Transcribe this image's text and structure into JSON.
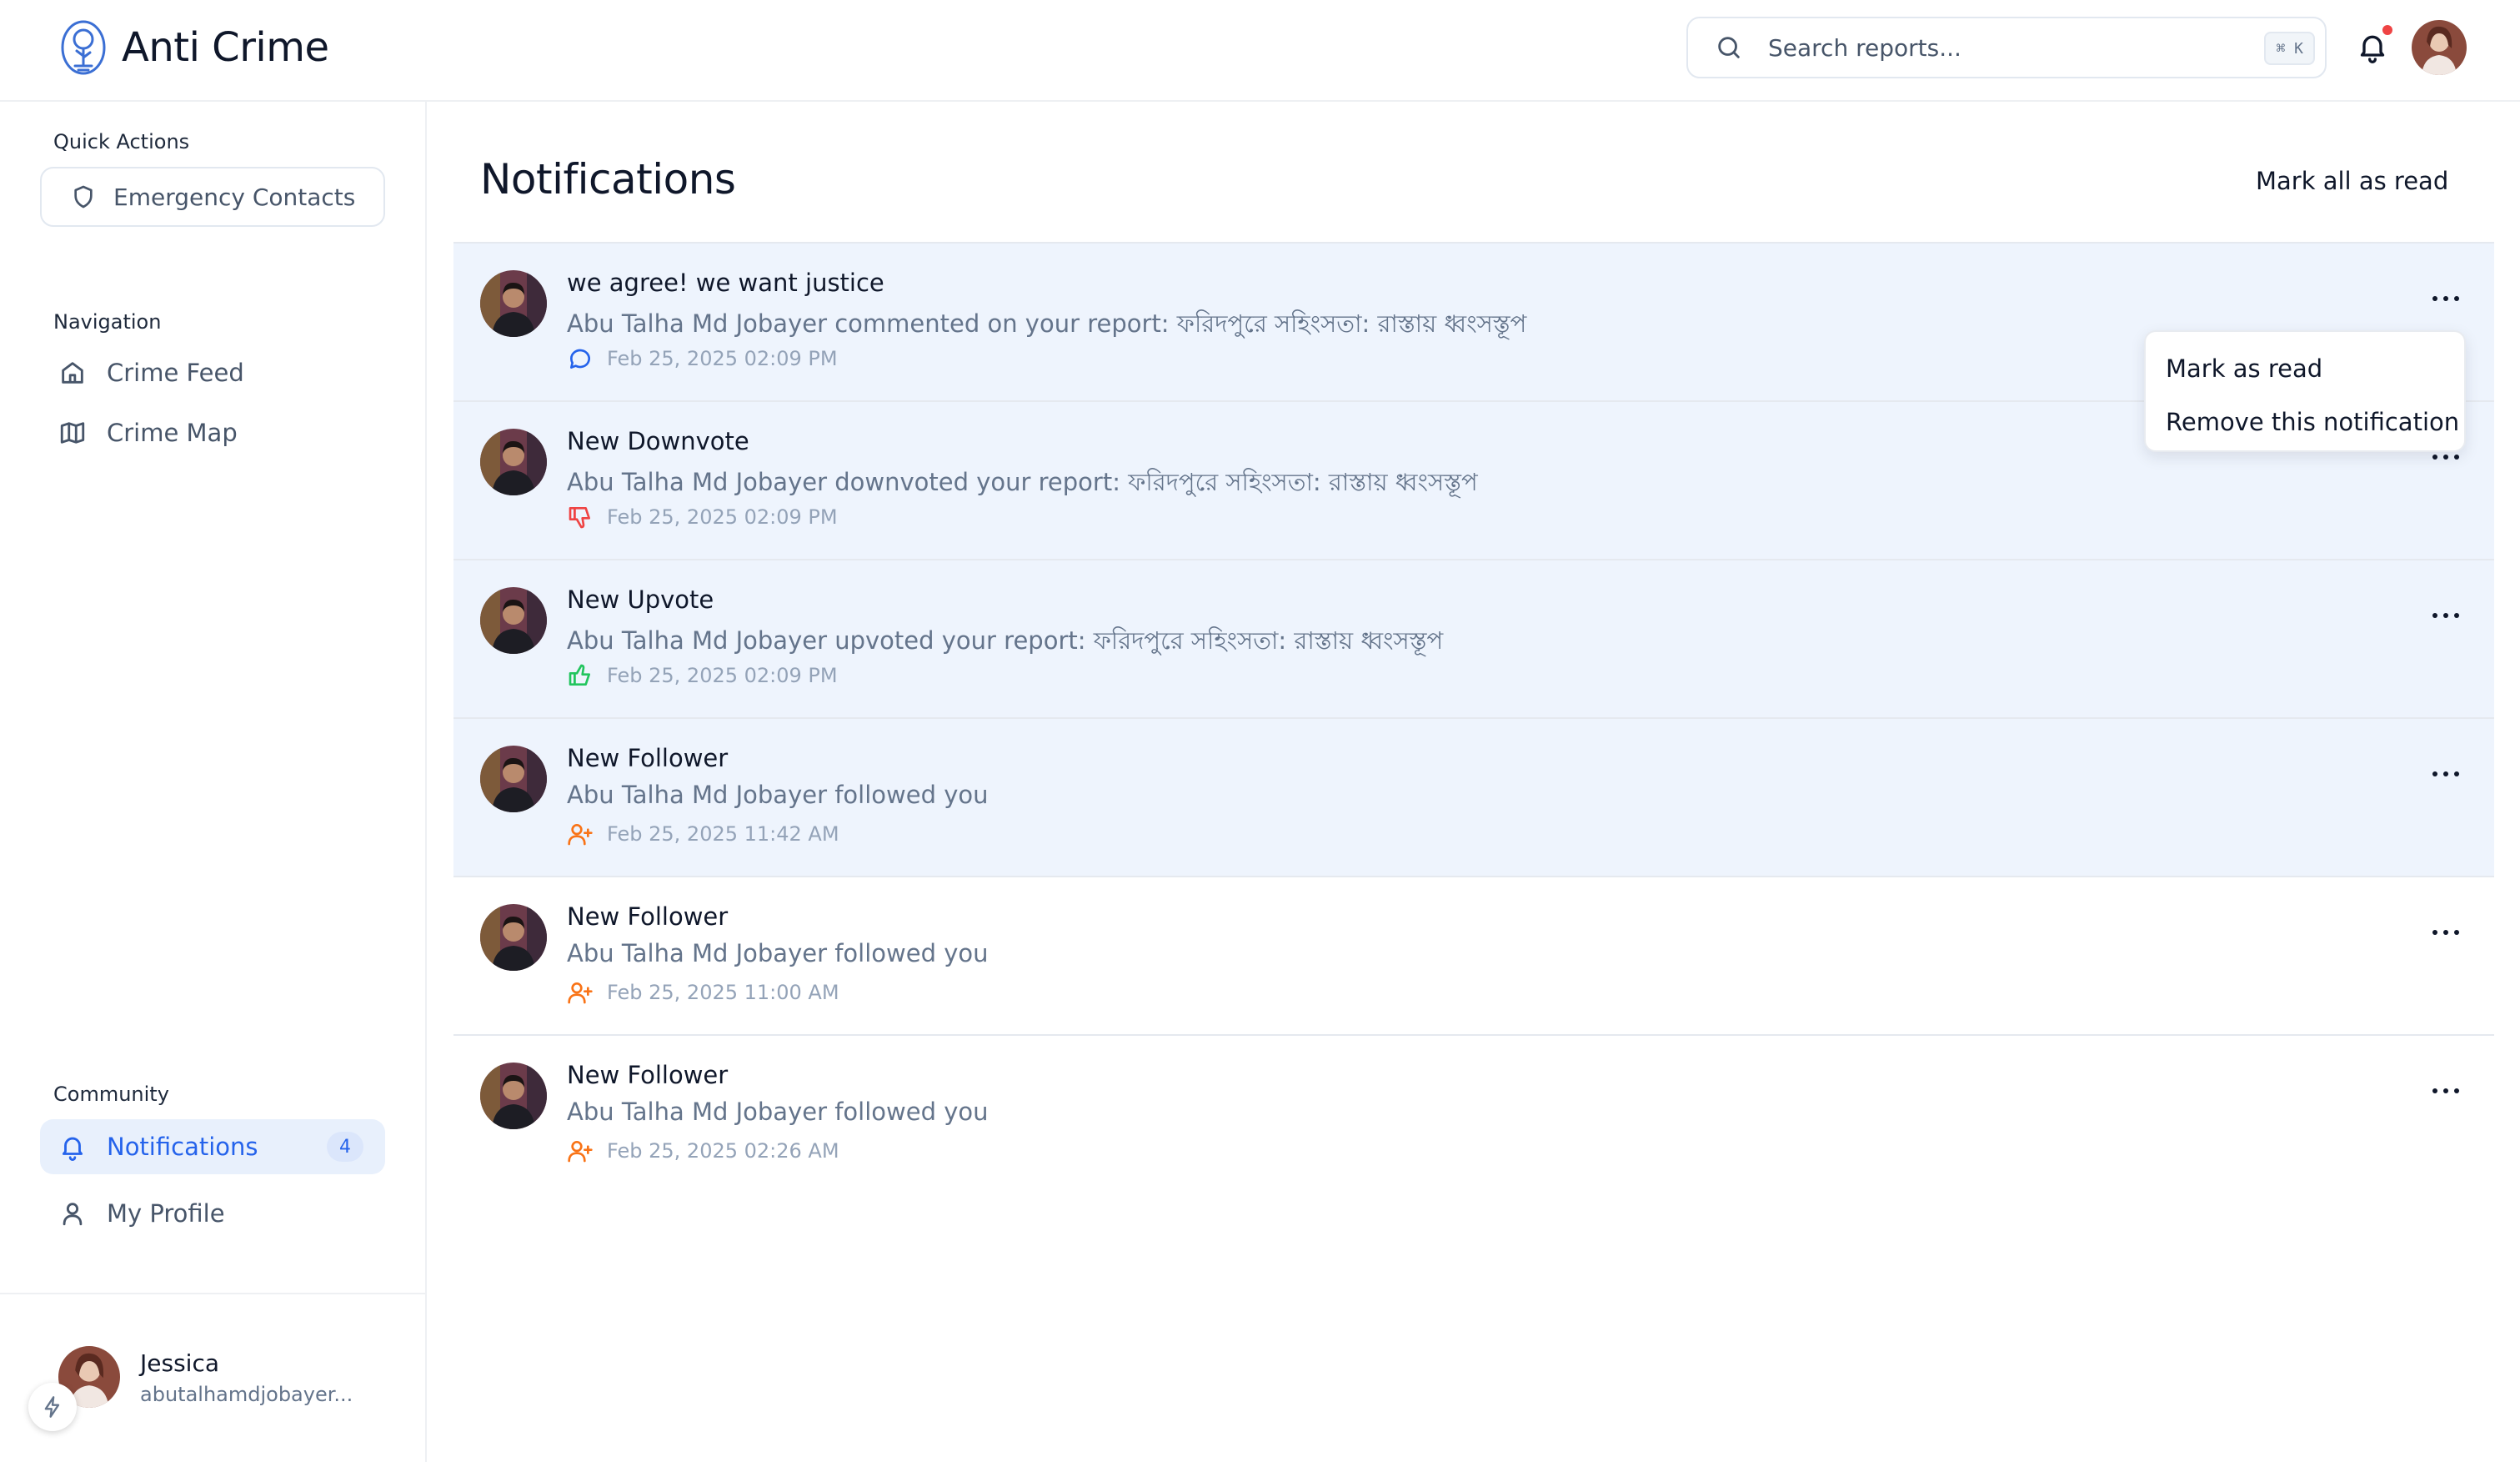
{
  "app": {
    "name": "Anti Crime"
  },
  "header": {
    "search_placeholder": "Search reports...",
    "search_shortcut": "⌘ K",
    "has_unread_dot": true
  },
  "sidebar": {
    "quick_actions": {
      "label": "Quick Actions",
      "emergency_contacts": "Emergency Contacts"
    },
    "navigation": {
      "label": "Navigation",
      "items": [
        {
          "label": "Crime Feed",
          "icon": "home-icon"
        },
        {
          "label": "Crime Map",
          "icon": "map-icon"
        }
      ]
    },
    "community": {
      "label": "Community",
      "items": [
        {
          "label": "Notifications",
          "icon": "bell-icon",
          "badge": "4",
          "active": true
        },
        {
          "label": "My Profile",
          "icon": "user-icon"
        }
      ]
    },
    "user": {
      "name": "Jessica",
      "handle": "abutalhamdjobayer..."
    }
  },
  "main": {
    "title": "Notifications",
    "mark_all_label": "Mark all as read",
    "menu": {
      "items": [
        "Mark as read",
        "Remove this notification"
      ]
    },
    "notifications": [
      {
        "title": "we agree! we want justice",
        "message": "Abu Talha Md Jobayer commented on your report: ফরিদপুরে সহিংসতা: রাস্তায় ধ্বংসস্তূপ",
        "time": "Feb 25, 2025 02:09 PM",
        "icon": "comment-icon",
        "icon_color": "#2563eb",
        "unread": true
      },
      {
        "title": "New Downvote",
        "message": "Abu Talha Md Jobayer downvoted your report: ফরিদপুরে সহিংসতা: রাস্তায় ধ্বংসস্তূপ",
        "time": "Feb 25, 2025 02:09 PM",
        "icon": "thumbs-down-icon",
        "icon_color": "#ef4444",
        "unread": true
      },
      {
        "title": "New Upvote",
        "message": "Abu Talha Md Jobayer upvoted your report: ফরিদপুরে সহিংসতা: রাস্তায় ধ্বংসস্তূপ",
        "time": "Feb 25, 2025 02:09 PM",
        "icon": "thumbs-up-icon",
        "icon_color": "#22c55e",
        "unread": true
      },
      {
        "title": "New Follower",
        "message": "Abu Talha Md Jobayer followed you",
        "time": "Feb 25, 2025 11:42 AM",
        "icon": "user-plus-icon",
        "icon_color": "#f97316",
        "unread": true
      },
      {
        "title": "New Follower",
        "message": "Abu Talha Md Jobayer followed you",
        "time": "Feb 25, 2025 11:00 AM",
        "icon": "user-plus-icon",
        "icon_color": "#f97316",
        "unread": false
      },
      {
        "title": "New Follower",
        "message": "Abu Talha Md Jobayer followed you",
        "time": "Feb 25, 2025 02:26 AM",
        "icon": "user-plus-icon",
        "icon_color": "#f97316",
        "unread": false
      }
    ]
  },
  "colors": {
    "accent": "#2563eb",
    "unread_bg": "#eef4fd",
    "active_nav_bg": "#e8f0fc",
    "notification_dot": "#ef4444"
  }
}
